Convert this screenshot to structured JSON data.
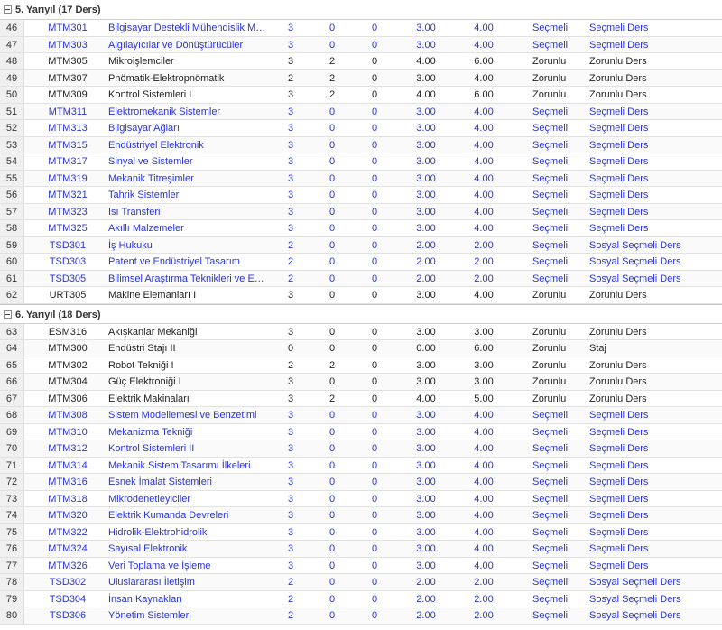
{
  "groups": [
    {
      "title": "5. Yarıyıl (17 Ders)",
      "rows": [
        {
          "idx": "46",
          "code": "MTM301",
          "name": "Bilgisayar Destekli Mühendislik Matem…",
          "t": "3",
          "u": "0",
          "l": "0",
          "kr": "3.00",
          "ects": "4.00",
          "type": "Seçmeli",
          "cat": "Seçmeli Ders",
          "elective": true
        },
        {
          "idx": "47",
          "code": "MTM303",
          "name": "Algılayıcılar ve Dönüştürücüler",
          "t": "3",
          "u": "0",
          "l": "0",
          "kr": "3.00",
          "ects": "4.00",
          "type": "Seçmeli",
          "cat": "Seçmeli Ders",
          "elective": true
        },
        {
          "idx": "48",
          "code": "MTM305",
          "name": "Mikroişlemciler",
          "t": "3",
          "u": "2",
          "l": "0",
          "kr": "4.00",
          "ects": "6.00",
          "type": "Zorunlu",
          "cat": "Zorunlu Ders",
          "elective": false
        },
        {
          "idx": "49",
          "code": "MTM307",
          "name": "Pnömatik-Elektropnömatik",
          "t": "2",
          "u": "2",
          "l": "0",
          "kr": "3.00",
          "ects": "4.00",
          "type": "Zorunlu",
          "cat": "Zorunlu Ders",
          "elective": false
        },
        {
          "idx": "50",
          "code": "MTM309",
          "name": "Kontrol Sistemleri I",
          "t": "3",
          "u": "2",
          "l": "0",
          "kr": "4.00",
          "ects": "6.00",
          "type": "Zorunlu",
          "cat": "Zorunlu Ders",
          "elective": false
        },
        {
          "idx": "51",
          "code": "MTM311",
          "name": "Elektromekanik Sistemler",
          "t": "3",
          "u": "0",
          "l": "0",
          "kr": "3.00",
          "ects": "4.00",
          "type": "Seçmeli",
          "cat": "Seçmeli Ders",
          "elective": true
        },
        {
          "idx": "52",
          "code": "MTM313",
          "name": "Bilgisayar Ağları",
          "t": "3",
          "u": "0",
          "l": "0",
          "kr": "3.00",
          "ects": "4.00",
          "type": "Seçmeli",
          "cat": "Seçmeli Ders",
          "elective": true
        },
        {
          "idx": "53",
          "code": "MTM315",
          "name": "Endüstriyel Elektronik",
          "t": "3",
          "u": "0",
          "l": "0",
          "kr": "3.00",
          "ects": "4.00",
          "type": "Seçmeli",
          "cat": "Seçmeli Ders",
          "elective": true
        },
        {
          "idx": "54",
          "code": "MTM317",
          "name": "Sinyal ve Sistemler",
          "t": "3",
          "u": "0",
          "l": "0",
          "kr": "3.00",
          "ects": "4.00",
          "type": "Seçmeli",
          "cat": "Seçmeli Ders",
          "elective": true
        },
        {
          "idx": "55",
          "code": "MTM319",
          "name": "Mekanik Titreşimler",
          "t": "3",
          "u": "0",
          "l": "0",
          "kr": "3.00",
          "ects": "4.00",
          "type": "Seçmeli",
          "cat": "Seçmeli Ders",
          "elective": true
        },
        {
          "idx": "56",
          "code": "MTM321",
          "name": "Tahrik Sistemleri",
          "t": "3",
          "u": "0",
          "l": "0",
          "kr": "3.00",
          "ects": "4.00",
          "type": "Seçmeli",
          "cat": "Seçmeli Ders",
          "elective": true
        },
        {
          "idx": "57",
          "code": "MTM323",
          "name": "Isı Transferi",
          "t": "3",
          "u": "0",
          "l": "0",
          "kr": "3.00",
          "ects": "4.00",
          "type": "Seçmeli",
          "cat": "Seçmeli Ders",
          "elective": true
        },
        {
          "idx": "58",
          "code": "MTM325",
          "name": "Akıllı Malzemeler",
          "t": "3",
          "u": "0",
          "l": "0",
          "kr": "3.00",
          "ects": "4.00",
          "type": "Seçmeli",
          "cat": "Seçmeli Ders",
          "elective": true
        },
        {
          "idx": "59",
          "code": "TSD301",
          "name": "İş Hukuku",
          "t": "2",
          "u": "0",
          "l": "0",
          "kr": "2.00",
          "ects": "2.00",
          "type": "Seçmeli",
          "cat": "Sosyal Seçmeli Ders",
          "elective": true
        },
        {
          "idx": "60",
          "code": "TSD303",
          "name": "Patent ve Endüstriyel Tasarım",
          "t": "2",
          "u": "0",
          "l": "0",
          "kr": "2.00",
          "ects": "2.00",
          "type": "Seçmeli",
          "cat": "Sosyal Seçmeli Ders",
          "elective": true
        },
        {
          "idx": "61",
          "code": "TSD305",
          "name": "Bilimsel Araştırma Teknikleri ve Etkili …",
          "t": "2",
          "u": "0",
          "l": "0",
          "kr": "2.00",
          "ects": "2.00",
          "type": "Seçmeli",
          "cat": "Sosyal Seçmeli Ders",
          "elective": true
        },
        {
          "idx": "62",
          "code": "URT305",
          "name": "Makine Elemanları I",
          "t": "3",
          "u": "0",
          "l": "0",
          "kr": "3.00",
          "ects": "4.00",
          "type": "Zorunlu",
          "cat": "Zorunlu Ders",
          "elective": false
        }
      ]
    },
    {
      "title": "6. Yarıyıl (18 Ders)",
      "rows": [
        {
          "idx": "63",
          "code": "ESM316",
          "name": "Akışkanlar Mekaniği",
          "t": "3",
          "u": "0",
          "l": "0",
          "kr": "3.00",
          "ects": "3.00",
          "type": "Zorunlu",
          "cat": "Zorunlu Ders",
          "elective": false
        },
        {
          "idx": "64",
          "code": "MTM300",
          "name": "Endüstri Stajı II",
          "t": "0",
          "u": "0",
          "l": "0",
          "kr": "0.00",
          "ects": "6.00",
          "type": "Zorunlu",
          "cat": "Staj",
          "elective": false
        },
        {
          "idx": "65",
          "code": "MTM302",
          "name": "Robot Tekniği I",
          "t": "2",
          "u": "2",
          "l": "0",
          "kr": "3.00",
          "ects": "3.00",
          "type": "Zorunlu",
          "cat": "Zorunlu Ders",
          "elective": false
        },
        {
          "idx": "66",
          "code": "MTM304",
          "name": "Güç Elektroniği I",
          "t": "3",
          "u": "0",
          "l": "0",
          "kr": "3.00",
          "ects": "3.00",
          "type": "Zorunlu",
          "cat": "Zorunlu Ders",
          "elective": false
        },
        {
          "idx": "67",
          "code": "MTM306",
          "name": "Elektrik Makinaları",
          "t": "3",
          "u": "2",
          "l": "0",
          "kr": "4.00",
          "ects": "5.00",
          "type": "Zorunlu",
          "cat": "Zorunlu Ders",
          "elective": false
        },
        {
          "idx": "68",
          "code": "MTM308",
          "name": "Sistem Modellemesi ve Benzetimi",
          "t": "3",
          "u": "0",
          "l": "0",
          "kr": "3.00",
          "ects": "4.00",
          "type": "Seçmeli",
          "cat": "Seçmeli Ders",
          "elective": true
        },
        {
          "idx": "69",
          "code": "MTM310",
          "name": "Mekanizma Tekniği",
          "t": "3",
          "u": "0",
          "l": "0",
          "kr": "3.00",
          "ects": "4.00",
          "type": "Seçmeli",
          "cat": "Seçmeli Ders",
          "elective": true
        },
        {
          "idx": "70",
          "code": "MTM312",
          "name": "Kontrol Sistemleri II",
          "t": "3",
          "u": "0",
          "l": "0",
          "kr": "3.00",
          "ects": "4.00",
          "type": "Seçmeli",
          "cat": "Seçmeli Ders",
          "elective": true
        },
        {
          "idx": "71",
          "code": "MTM314",
          "name": "Mekanik Sistem Tasarımı İlkeleri",
          "t": "3",
          "u": "0",
          "l": "0",
          "kr": "3.00",
          "ects": "4.00",
          "type": "Seçmeli",
          "cat": "Seçmeli Ders",
          "elective": true
        },
        {
          "idx": "72",
          "code": "MTM316",
          "name": "Esnek İmalat Sistemleri",
          "t": "3",
          "u": "0",
          "l": "0",
          "kr": "3.00",
          "ects": "4.00",
          "type": "Seçmeli",
          "cat": "Seçmeli Ders",
          "elective": true
        },
        {
          "idx": "73",
          "code": "MTM318",
          "name": "Mikrodenetleyiciler",
          "t": "3",
          "u": "0",
          "l": "0",
          "kr": "3.00",
          "ects": "4.00",
          "type": "Seçmeli",
          "cat": "Seçmeli Ders",
          "elective": true
        },
        {
          "idx": "74",
          "code": "MTM320",
          "name": "Elektrik Kumanda Devreleri",
          "t": "3",
          "u": "0",
          "l": "0",
          "kr": "3.00",
          "ects": "4.00",
          "type": "Seçmeli",
          "cat": "Seçmeli Ders",
          "elective": true
        },
        {
          "idx": "75",
          "code": "MTM322",
          "name": "Hidrolik-Elektrohidrolik",
          "t": "3",
          "u": "0",
          "l": "0",
          "kr": "3.00",
          "ects": "4.00",
          "type": "Seçmeli",
          "cat": "Seçmeli Ders",
          "elective": true
        },
        {
          "idx": "76",
          "code": "MTM324",
          "name": "Sayısal Elektronik",
          "t": "3",
          "u": "0",
          "l": "0",
          "kr": "3.00",
          "ects": "4.00",
          "type": "Seçmeli",
          "cat": "Seçmeli Ders",
          "elective": true
        },
        {
          "idx": "77",
          "code": "MTM326",
          "name": "Veri Toplama ve İşleme",
          "t": "3",
          "u": "0",
          "l": "0",
          "kr": "3.00",
          "ects": "4.00",
          "type": "Seçmeli",
          "cat": "Seçmeli Ders",
          "elective": true
        },
        {
          "idx": "78",
          "code": "TSD302",
          "name": "Uluslararası İletişim",
          "t": "2",
          "u": "0",
          "l": "0",
          "kr": "2.00",
          "ects": "2.00",
          "type": "Seçmeli",
          "cat": "Sosyal Seçmeli Ders",
          "elective": true
        },
        {
          "idx": "79",
          "code": "TSD304",
          "name": "İnsan Kaynakları",
          "t": "2",
          "u": "0",
          "l": "0",
          "kr": "2.00",
          "ects": "2.00",
          "type": "Seçmeli",
          "cat": "Sosyal Seçmeli Ders",
          "elective": true
        },
        {
          "idx": "80",
          "code": "TSD306",
          "name": "Yönetim Sistemleri",
          "t": "2",
          "u": "0",
          "l": "0",
          "kr": "2.00",
          "ects": "2.00",
          "type": "Seçmeli",
          "cat": "Sosyal Seçmeli Ders",
          "elective": true
        }
      ]
    }
  ]
}
